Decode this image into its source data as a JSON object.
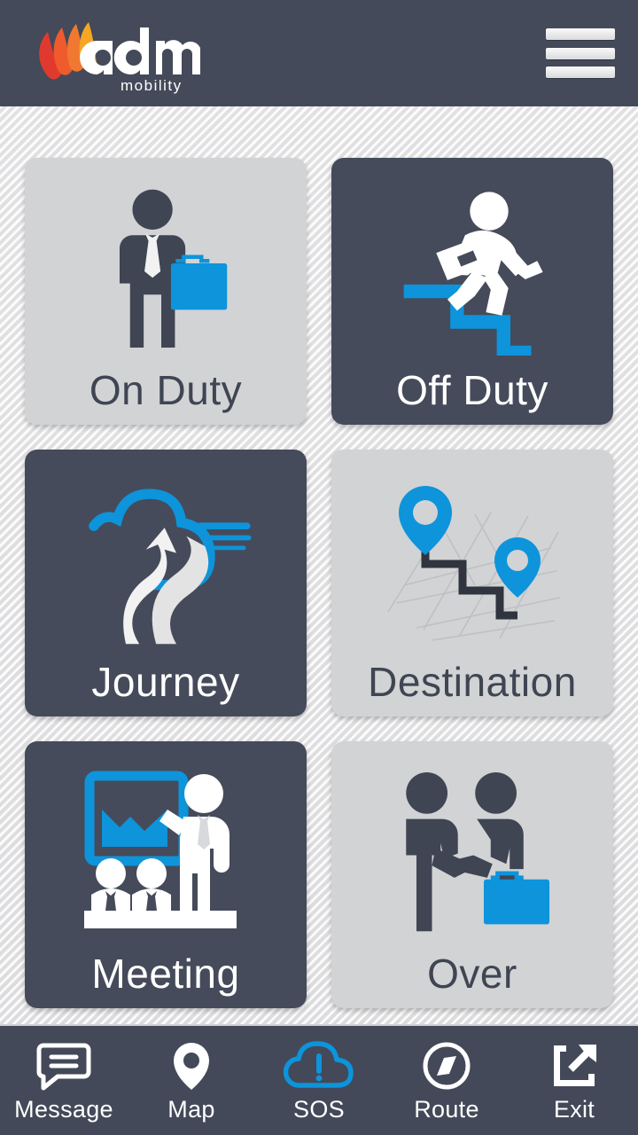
{
  "header": {
    "brand_name": "adm",
    "brand_sub": "mobility",
    "menu_label": "menu"
  },
  "colors": {
    "header_bg": "#444a59",
    "tile_dark": "#454b5a",
    "tile_light": "#d2d3d5",
    "accent_blue": "#0d94db",
    "page_bg": "#e9e9e9",
    "nav_bg": "#434959",
    "logo_red": "#e03a2f",
    "logo_orange": "#f07830",
    "logo_yellow": "#f5a623"
  },
  "grid": {
    "tiles": [
      {
        "id": "on-duty",
        "label": "On Duty",
        "theme": "light",
        "icon": "businessman-briefcase-icon"
      },
      {
        "id": "off-duty",
        "label": "Off Duty",
        "theme": "dark",
        "icon": "running-man-stairs-icon"
      },
      {
        "id": "journey",
        "label": "Journey",
        "theme": "dark",
        "icon": "road-cloud-icon"
      },
      {
        "id": "destination",
        "label": "Destination",
        "theme": "light",
        "icon": "map-pins-route-icon"
      },
      {
        "id": "meeting",
        "label": "Meeting",
        "theme": "dark",
        "icon": "presentation-meeting-icon"
      },
      {
        "id": "over",
        "label": "Over",
        "theme": "light",
        "icon": "handshake-briefcase-icon"
      }
    ]
  },
  "bottom_nav": {
    "items": [
      {
        "id": "message",
        "label": "Message",
        "icon": "speech-bubble-icon",
        "active": false
      },
      {
        "id": "map",
        "label": "Map",
        "icon": "map-pin-icon",
        "active": false
      },
      {
        "id": "sos",
        "label": "SOS",
        "icon": "cloud-alert-icon",
        "active": true
      },
      {
        "id": "route",
        "label": "Route",
        "icon": "compass-icon",
        "active": false
      },
      {
        "id": "exit",
        "label": "Exit",
        "icon": "external-link-icon",
        "active": false
      }
    ]
  }
}
